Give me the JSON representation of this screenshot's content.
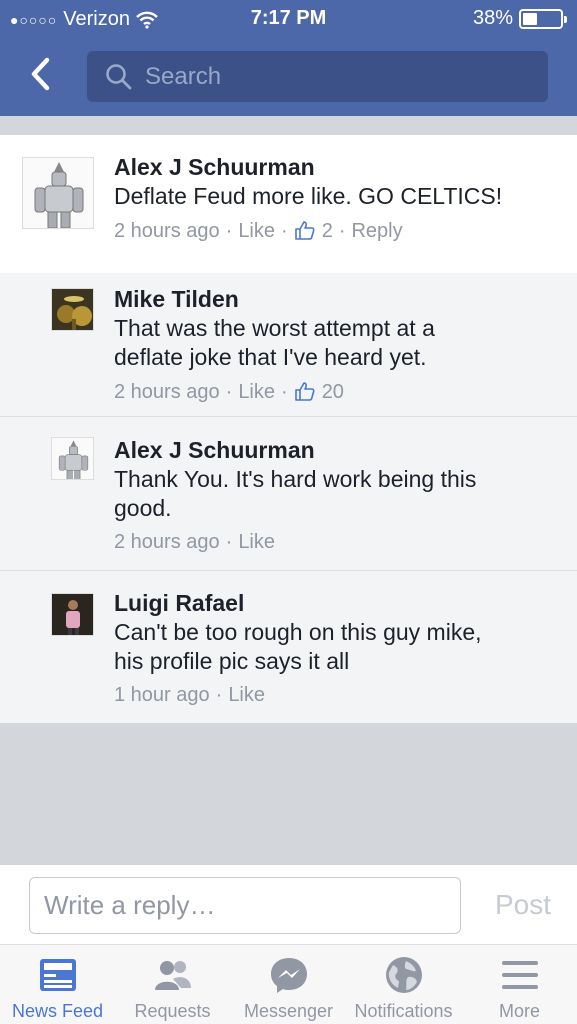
{
  "status_bar": {
    "carrier": "Verizon",
    "time": "7:17 PM",
    "battery": "38%",
    "battery_level": 0.38
  },
  "nav": {
    "back_icon": "chevron-left-icon",
    "search_placeholder": "Search"
  },
  "comments": [
    {
      "author": "Alex J Schuurman",
      "text": "Deflate Feud more like. GO CELTICS!",
      "time": "2 hours ago",
      "like_label": "Like",
      "likes": "2",
      "reply_label": "Reply"
    },
    {
      "author": "Mike Tilden",
      "text_line1": "That was the worst attempt at a",
      "text_line2": "deflate joke that I've heard yet.",
      "time": "2 hours ago",
      "like_label": "Like",
      "likes": "20"
    },
    {
      "author": "Alex J Schuurman",
      "text_line1": "Thank You. It's hard work being this",
      "text_line2": "good.",
      "time": "2 hours ago",
      "like_label": "Like"
    },
    {
      "author": "Luigi Rafael",
      "text_line1": "Can't be too rough on this guy mike,",
      "text_line2": "his profile pic says it all",
      "time": "1 hour ago",
      "like_label": "Like"
    }
  ],
  "reply_bar": {
    "placeholder": "Write a reply…",
    "post_label": "Post"
  },
  "tabs": [
    {
      "label": "News Feed",
      "icon": "news-feed-icon",
      "active": true
    },
    {
      "label": "Requests",
      "icon": "friend-requests-icon",
      "active": false
    },
    {
      "label": "Messenger",
      "icon": "messenger-icon",
      "active": false
    },
    {
      "label": "Notifications",
      "icon": "globe-icon",
      "active": false
    },
    {
      "label": "More",
      "icon": "menu-icon",
      "active": false
    }
  ],
  "colors": {
    "header": "#4d68a8",
    "accent": "#4a76d6",
    "muted": "#9197a3"
  }
}
